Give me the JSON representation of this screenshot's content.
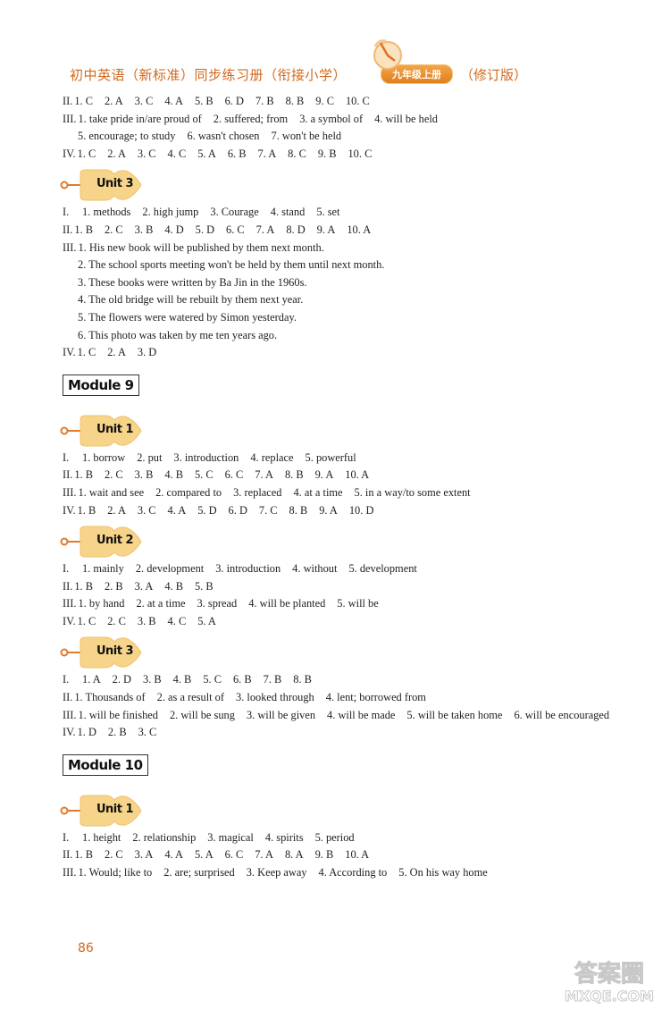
{
  "header": {
    "title": "初中英语（新标准）同步练习册（衔接小学）",
    "badge": "九年级上册",
    "edition": "（修订版）",
    "accent_color": "#d2691e"
  },
  "sections": [
    {
      "type": "lines",
      "lines": [
        {
          "label": "II.",
          "items": [
            "1. C",
            "2. A",
            "3. C",
            "4. A",
            "5. B",
            "6. D",
            "7. B",
            "8. B",
            "9. C",
            "10. C"
          ]
        },
        {
          "label": "III.",
          "items": [
            "1. take pride in/are proud of",
            "2. suffered; from",
            "3. a symbol of",
            "4. will be held"
          ]
        },
        {
          "label": "",
          "indent": true,
          "items": [
            "5. encourage; to study",
            "6. wasn't chosen",
            "7. won't be held"
          ]
        },
        {
          "label": "IV.",
          "items": [
            "1. C",
            "2. A",
            "3. C",
            "4. C",
            "5. A",
            "6. B",
            "7. A",
            "8. C",
            "9. B",
            "10. C"
          ]
        }
      ]
    }
  ],
  "module8_unit3": {
    "unit_label": "Unit 3",
    "lines": [
      {
        "label": "I.",
        "items": [
          "1. methods",
          "2. high jump",
          "3. Courage",
          "4. stand",
          "5. set"
        ]
      },
      {
        "label": "II.",
        "items": [
          "1. B",
          "2. C",
          "3. B",
          "4. D",
          "5. D",
          "6. C",
          "7. A",
          "8. D",
          "9. A",
          "10. A"
        ]
      },
      {
        "label": "III.",
        "items": [
          "1. His new book will be published by them next month."
        ]
      },
      {
        "label": "",
        "indent": true,
        "items": [
          "2. The school sports meeting won't be held by them until next month."
        ]
      },
      {
        "label": "",
        "indent": true,
        "items": [
          "3. These books were written by Ba Jin in the 1960s."
        ]
      },
      {
        "label": "",
        "indent": true,
        "items": [
          "4. The old bridge will be rebuilt by them next year."
        ]
      },
      {
        "label": "",
        "indent": true,
        "items": [
          "5. The flowers were watered by Simon yesterday."
        ]
      },
      {
        "label": "",
        "indent": true,
        "items": [
          "6. This photo was taken by me ten years ago."
        ]
      },
      {
        "label": "IV.",
        "items": [
          "1. C",
          "2. A",
          "3. D"
        ]
      }
    ]
  },
  "module9": {
    "title": "Module 9",
    "unit1": {
      "unit_label": "Unit 1",
      "lines": [
        {
          "label": "I.",
          "items": [
            "1. borrow",
            "2. put",
            "3. introduction",
            "4. replace",
            "5. powerful"
          ]
        },
        {
          "label": "II.",
          "items": [
            "1. B",
            "2. C",
            "3. B",
            "4. B",
            "5. C",
            "6. C",
            "7. A",
            "8. B",
            "9. A",
            "10. A"
          ]
        },
        {
          "label": "III.",
          "items": [
            "1. wait and see",
            "2. compared to",
            "3. replaced",
            "4. at a time",
            "5. in a way/to some extent"
          ]
        },
        {
          "label": "IV.",
          "items": [
            "1. B",
            "2. A",
            "3. C",
            "4. A",
            "5. D",
            "6. D",
            "7. C",
            "8. B",
            "9. A",
            "10. D"
          ]
        }
      ]
    },
    "unit2": {
      "unit_label": "Unit 2",
      "lines": [
        {
          "label": "I.",
          "items": [
            "1. mainly",
            "2. development",
            "3. introduction",
            "4. without",
            "5. development"
          ]
        },
        {
          "label": "II.",
          "items": [
            "1. B",
            "2. B",
            "3. A",
            "4. B",
            "5. B"
          ]
        },
        {
          "label": "III.",
          "items": [
            "1. by hand",
            "2. at a time",
            "3. spread",
            "4. will be planted",
            "5. will be"
          ]
        },
        {
          "label": "IV.",
          "items": [
            "1. C",
            "2. C",
            "3. B",
            "4. C",
            "5. A"
          ]
        }
      ]
    },
    "unit3": {
      "unit_label": "Unit 3",
      "lines": [
        {
          "label": "I.",
          "items": [
            "1. A",
            "2. D",
            "3. B",
            "4. B",
            "5. C",
            "6. B",
            "7. B",
            "8. B"
          ]
        },
        {
          "label": "II.",
          "items": [
            "1. Thousands of",
            "2. as a result of",
            "3. looked through",
            "4. lent; borrowed from"
          ]
        },
        {
          "label": "III.",
          "items": [
            "1. will be finished",
            "2. will be sung",
            "3. will be given",
            "4. will be made",
            "5. will be taken home",
            "6. will be encouraged"
          ]
        },
        {
          "label": "IV.",
          "items": [
            "1. D",
            "2. B",
            "3. C"
          ]
        }
      ]
    }
  },
  "module10": {
    "title": "Module 10",
    "unit1": {
      "unit_label": "Unit 1",
      "lines": [
        {
          "label": "I.",
          "items": [
            "1. height",
            "2. relationship",
            "3. magical",
            "4. spirits",
            "5. period"
          ]
        },
        {
          "label": "II.",
          "items": [
            "1. B",
            "2. C",
            "3. A",
            "4. A",
            "5. A",
            "6. C",
            "7. A",
            "8. A",
            "9. B",
            "10. A"
          ]
        },
        {
          "label": "III.",
          "items": [
            "1. Would; like to",
            "2. are; surprised",
            "3. Keep away",
            "4. According to",
            "5. On his way home"
          ]
        }
      ]
    }
  },
  "footer": {
    "page_number": "86",
    "watermark_cn": "答案圈",
    "watermark_en": "MXQE.COM"
  }
}
